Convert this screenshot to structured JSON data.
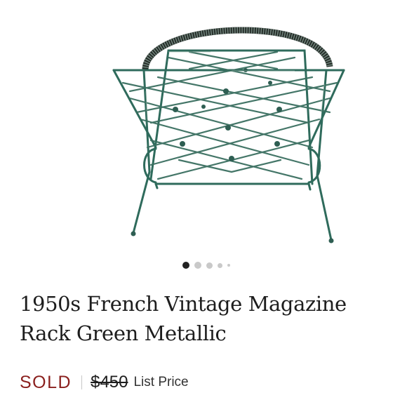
{
  "product": {
    "image_alt": "Green metal wire magazine rack with coiled handle",
    "title": "1950s French Vintage Magazine Rack Green Metallic",
    "status": "SOLD",
    "original_price": "$450",
    "price_label": "List Price"
  },
  "carousel": {
    "dot_count": 5,
    "active_index": 0
  },
  "colors": {
    "sold": "#8a1f1d",
    "rack_green": "#2f6b5c",
    "dot_active": "#222222",
    "dot_inactive": "#c9c9c9"
  }
}
